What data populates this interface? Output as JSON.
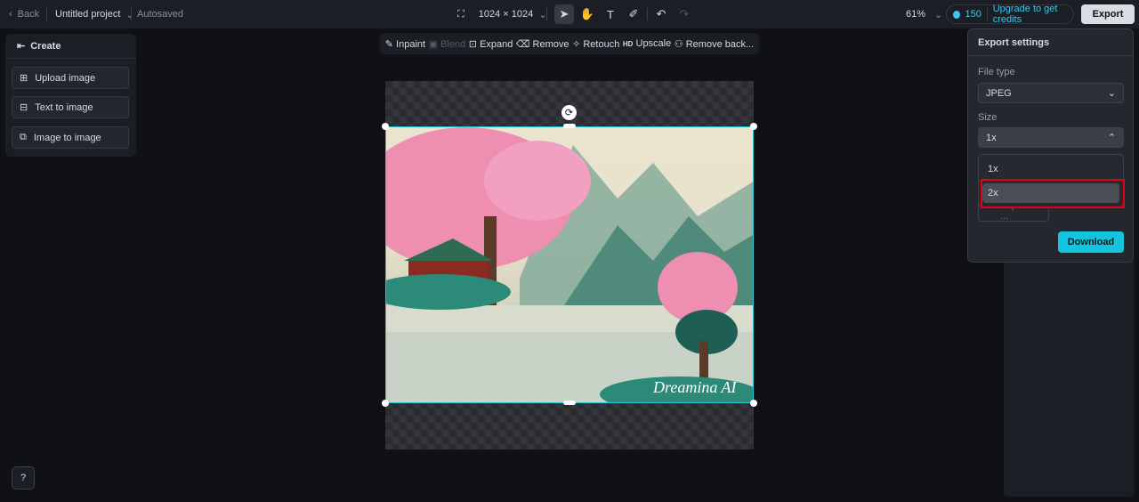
{
  "topbar": {
    "back": "Back",
    "project": "Untitled project",
    "autosaved": "Autosaved",
    "canvas_size": "1024 × 1024",
    "zoom": "61%",
    "credits": "150",
    "upgrade": "Upgrade to get credits",
    "export": "Export"
  },
  "left_panel": {
    "title": "Create",
    "items": [
      {
        "label": "Upload image"
      },
      {
        "label": "Text to image"
      },
      {
        "label": "Image to image"
      }
    ]
  },
  "edit_toolbar": {
    "items": [
      {
        "label": "Inpaint",
        "icon": "✎"
      },
      {
        "label": "Blend",
        "icon": "▣",
        "disabled": true
      },
      {
        "label": "Expand",
        "icon": "⊡"
      },
      {
        "label": "Remove",
        "icon": "⌫"
      },
      {
        "label": "Retouch",
        "icon": "✧"
      },
      {
        "label": "Upscale",
        "icon": "HD"
      },
      {
        "label": "Remove back...",
        "icon": "⚇"
      }
    ]
  },
  "canvas": {
    "watermark": "Dreamina AI"
  },
  "export_panel": {
    "title": "Export settings",
    "file_type_label": "File type",
    "file_type": "JPEG",
    "size_label": "Size",
    "size": "1x",
    "options": [
      "1x",
      "2x"
    ],
    "highlighted": "2x",
    "export_all": "Export all ...",
    "download": "Download"
  },
  "colors": {
    "accent": "#13c4dc",
    "selection": "#27c6d1",
    "highlight_box": "#e3001b"
  }
}
